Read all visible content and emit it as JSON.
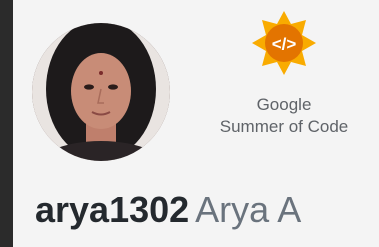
{
  "profile": {
    "username": "arya1302",
    "full_name": "Arya A",
    "avatar_icon": "profile-photo"
  },
  "badge": {
    "icon": "gsoc-sun-code-icon",
    "line1": "Google",
    "line2": "Summer of Code",
    "color_outer": "#f9ab00",
    "color_inner": "#e37400"
  }
}
